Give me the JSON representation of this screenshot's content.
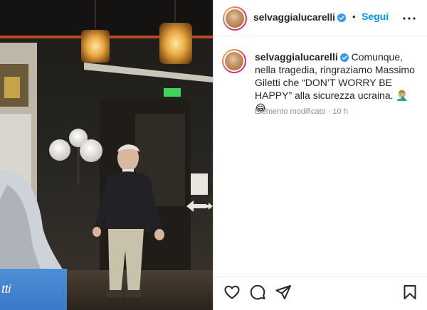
{
  "post": {
    "username": "selvaggialucarelli",
    "follow_label": "Segui",
    "dot": "•",
    "caption": "Comunque, nella tragedia, ringraziamo Massimo Giletti che “DON’T WORRY BE HAPPY” alla sicurezza ucraina. 🤦🏼‍♂️😂",
    "meta": "Elemento modificato · 10 h"
  },
  "media": {
    "banner_text": "tti"
  },
  "icons": {
    "more": "more-horizontal-icon",
    "like": "heart-icon",
    "comment": "comment-icon",
    "share": "share-icon",
    "save": "bookmark-icon",
    "verified": "verified-badge-icon"
  },
  "colors": {
    "accent": "#0095f6",
    "text": "#262626",
    "muted": "#8e8e8e",
    "verified": "#3897f0"
  }
}
